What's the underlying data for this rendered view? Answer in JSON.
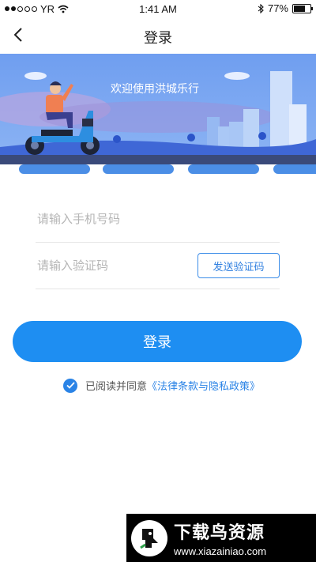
{
  "status_bar": {
    "carrier": "YR",
    "time": "1:41 AM",
    "battery": "77%",
    "battery_level": 0.77
  },
  "nav": {
    "title": "登录",
    "back_icon": "chevron-left-icon"
  },
  "banner": {
    "text": "欢迎使用洪城乐行"
  },
  "form": {
    "phone_placeholder": "请输入手机号码",
    "code_placeholder": "请输入验证码",
    "send_code_label": "发送验证码"
  },
  "login_button": "登录",
  "agreement": {
    "checked": true,
    "prefix": "已阅读并同意",
    "policy_link": "《法律条款与隐私政策》"
  },
  "watermark": {
    "title": "下载鸟资源",
    "url": "www.xiazainiao.com"
  },
  "colors": {
    "accent": "#1e8ef2",
    "banner_bg": "#5b8fe8"
  }
}
